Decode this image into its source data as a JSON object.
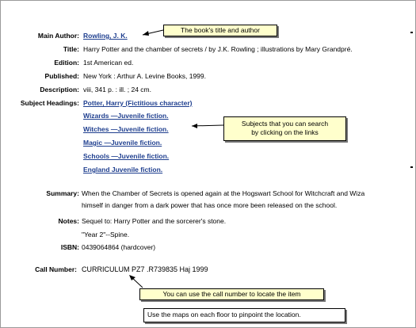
{
  "record": {
    "main_author": {
      "label": "Main Author:",
      "value": "Rowling, J. K."
    },
    "title": {
      "label": "Title:",
      "value": "Harry Potter and the chamber of secrets / by J.K. Rowling ; illustrations by Mary Grandpré."
    },
    "edition": {
      "label": "Edition:",
      "value": "1st American ed."
    },
    "published": {
      "label": "Published:",
      "value": "New York : Arthur A. Levine Books, 1999."
    },
    "description": {
      "label": "Description:",
      "value": "viii, 341 p. : ill. ; 24 cm."
    },
    "subjects": {
      "label": "Subject Headings:",
      "items": [
        "Potter, Harry (Fictitious character)",
        "Wizards —Juvenile fiction.",
        "Witches —Juvenile fiction.",
        "Magic —Juvenile fiction.",
        "Schools —Juvenile fiction.",
        "England Juvenile fiction."
      ]
    },
    "summary": {
      "label": "Summary:",
      "line1": "When the Chamber of Secrets is opened again at the Hogswart School for Witchcraft and Wiza",
      "line2": "himself in danger from a dark power that has once more been released on the school."
    },
    "notes": {
      "label": "Notes:",
      "line1": "Sequel to: Harry Potter and the sorcerer's stone.",
      "line2": "\"Year 2\"--Spine."
    },
    "isbn": {
      "label": "ISBN:",
      "value": "0439064864 (hardcover)"
    },
    "call_number": {
      "label": "Call Number:",
      "value": "CURRICULUM PZ7 .R739835 Haj 1999"
    }
  },
  "callouts": {
    "title_author": "The book's title and author",
    "subjects_line1": "Subjects that you can search",
    "subjects_line2": "by clicking on the links",
    "call_number": "You can use the call number to locate the item",
    "maps": "Use the maps on each floor to pinpoint the location."
  }
}
